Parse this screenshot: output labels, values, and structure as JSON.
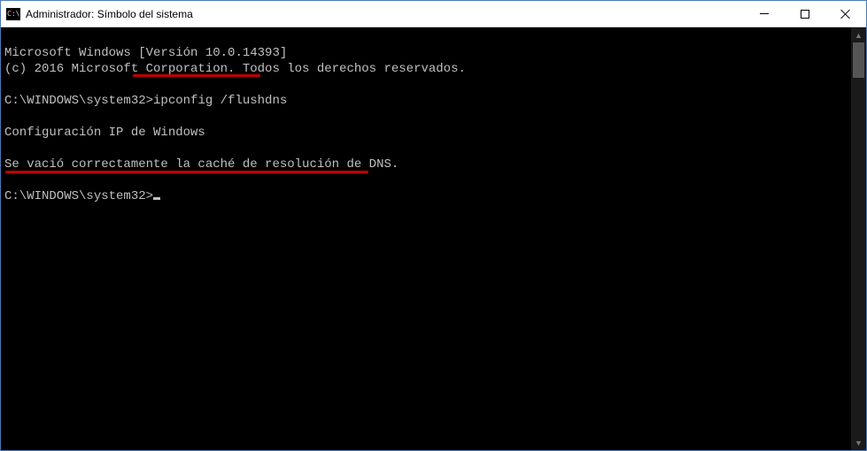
{
  "window": {
    "icon_label": "C:\\",
    "title": "Administrador: Símbolo del sistema"
  },
  "terminal": {
    "line1": "Microsoft Windows [Versión 10.0.14393]",
    "line2": "(c) 2016 Microsoft Corporation. Todos los derechos reservados.",
    "prompt1_path": "C:\\WINDOWS\\system32>",
    "prompt1_cmd": "ipconfig /flushdns",
    "blank": "",
    "result_header": "Configuración IP de Windows",
    "result_msg": "Se vació correctamente la caché de resolución de DNS.",
    "prompt2_path": "C:\\WINDOWS\\system32>"
  }
}
